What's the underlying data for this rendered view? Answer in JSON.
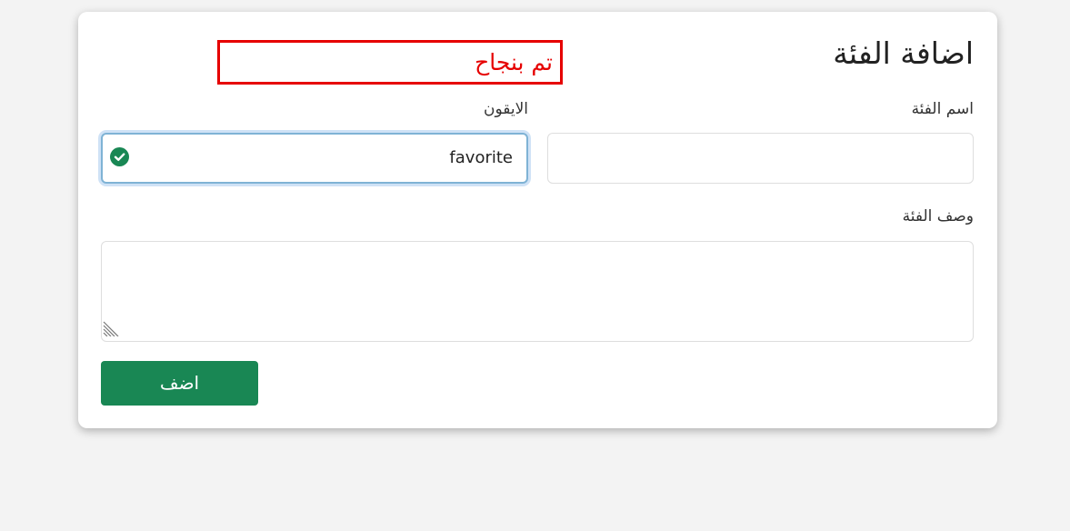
{
  "form": {
    "title": "اضافة الفئة",
    "success_message": "تم بنجاح",
    "name_label": "اسم الفئة",
    "name_value": "",
    "icon_label": "الايقون",
    "icon_value": "favorite",
    "description_label": "وصف الفئة",
    "description_value": "",
    "submit_label": "اضف"
  },
  "colors": {
    "accent": "#198754",
    "error": "#e60000",
    "focus": "#7fb3d5"
  },
  "icons": {
    "valid_indicator": "check-circle-icon",
    "resize_handle": "resize-grip-icon"
  }
}
